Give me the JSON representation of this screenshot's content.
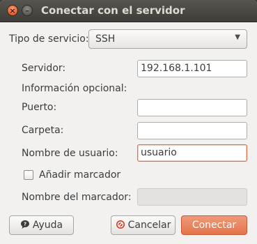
{
  "window": {
    "title": "Conectar con el servidor",
    "close_glyph": "×",
    "minimize_glyph": "–"
  },
  "form": {
    "service_type": {
      "label": "Tipo de servicio:",
      "value": "SSH"
    },
    "server": {
      "label": "Servidor:",
      "value": "192.168.1.101"
    },
    "optional_info_label": "Información opcional:",
    "port": {
      "label": "Puerto:",
      "value": ""
    },
    "folder": {
      "label": "Carpeta:",
      "value": ""
    },
    "username": {
      "label": "Nombre de usuario:",
      "value": "usuario"
    },
    "add_bookmark": {
      "label": "Añadir marcador",
      "checked": false
    },
    "bookmark_name": {
      "label": "Nombre del marcador:",
      "value": "",
      "enabled": false
    }
  },
  "buttons": {
    "help": {
      "label": "Ayuda",
      "icon": "help-icon"
    },
    "cancel": {
      "label": "Cancelar",
      "icon": "cancel-icon"
    },
    "connect": {
      "label": "Conectar"
    }
  },
  "colors": {
    "accent": "#e3744a",
    "titlebar": "#3e3d39",
    "window_bg": "#f2f1f0"
  }
}
